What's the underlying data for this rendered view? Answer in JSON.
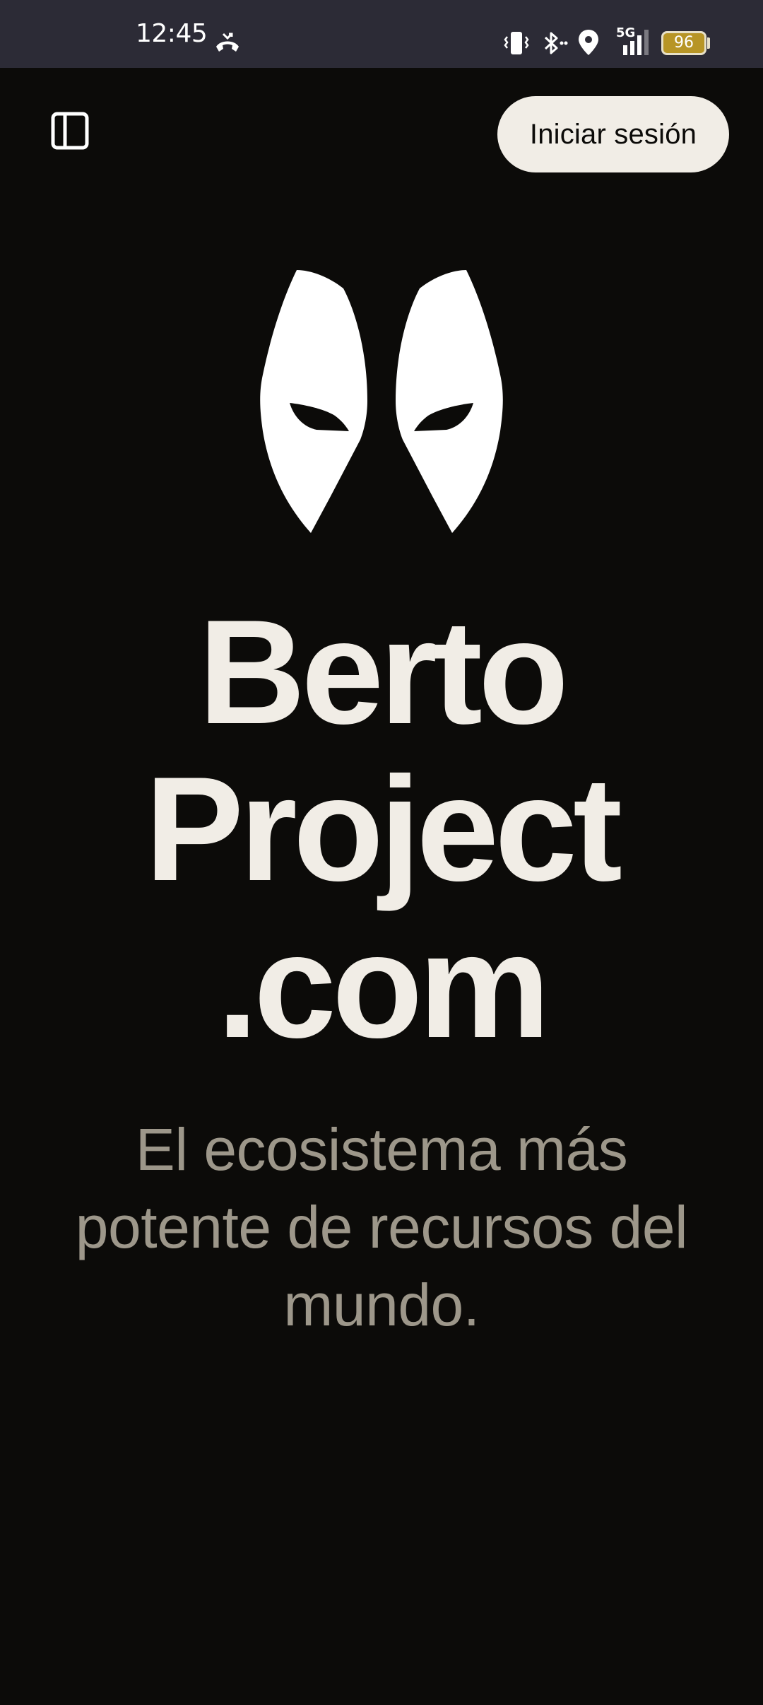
{
  "status_bar": {
    "time": "12:45",
    "battery_level": "96",
    "network_label": "5G",
    "icons": [
      "missed-call-icon",
      "vibrate-icon",
      "bluetooth-icon",
      "location-icon",
      "signal-5g-icon",
      "battery-icon"
    ]
  },
  "header": {
    "sidebar_icon": "sidebar-toggle-icon",
    "login_label": "Iniciar sesión"
  },
  "hero": {
    "logo_icon": "mask-eyes-logo",
    "title_lines": [
      "Berto",
      "Project",
      ".com"
    ],
    "subtitle": "El ecosistema más potente de recursos del mundo."
  },
  "colors": {
    "background": "#0c0b09",
    "status_bar": "#2c2b36",
    "title": "#f1ede6",
    "subtitle": "#9d978a",
    "button_bg": "#f1ede6",
    "battery_fill": "#b79526"
  }
}
